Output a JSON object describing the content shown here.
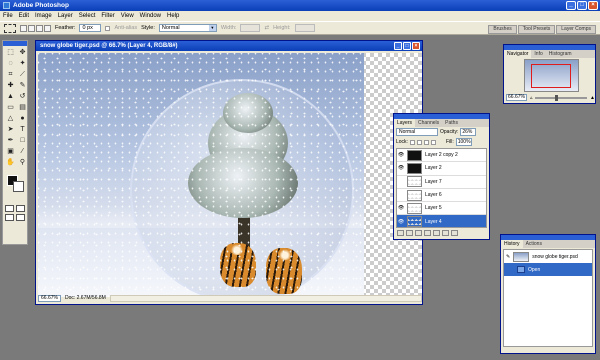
{
  "app": {
    "title": "Adobe Photoshop"
  },
  "menu": [
    "File",
    "Edit",
    "Image",
    "Layer",
    "Select",
    "Filter",
    "View",
    "Window",
    "Help"
  ],
  "options": {
    "feather_label": "Feather:",
    "feather_value": "0 px",
    "antialias_label": "Anti-alias",
    "style_label": "Style:",
    "style_value": "Normal",
    "width_label": "Width:",
    "height_label": "Height:"
  },
  "palette_well": [
    "Brushes",
    "Tool Presets",
    "Layer Comps"
  ],
  "document": {
    "title": "snow globe tiger.psd @ 66.7% (Layer 4, RGB/8#)",
    "zoom": "66.67%",
    "doc_size": "Doc: 2.67M/56.8M"
  },
  "navigator": {
    "tabs": [
      "Navigator",
      "Info",
      "Histogram"
    ],
    "zoom": "66.67%"
  },
  "layers": {
    "tabs": [
      "Layers",
      "Channels",
      "Paths"
    ],
    "blend_mode": "Normal",
    "opacity_label": "Opacity:",
    "opacity_value": "26%",
    "lock_label": "Lock:",
    "fill_label": "Fill:",
    "fill_value": "100%",
    "items": [
      {
        "name": "Layer 2 copy 2",
        "visible": true,
        "thumb": "dark"
      },
      {
        "name": "Layer 2",
        "visible": true,
        "thumb": "dark"
      },
      {
        "name": "Layer 7",
        "visible": false,
        "thumb": "checker"
      },
      {
        "name": "Layer 6",
        "visible": false,
        "thumb": "checker"
      },
      {
        "name": "Layer 5",
        "visible": true,
        "thumb": "checker"
      },
      {
        "name": "Layer 4",
        "visible": true,
        "thumb": "checker",
        "selected": true
      }
    ]
  },
  "history": {
    "tabs": [
      "History",
      "Actions"
    ],
    "snapshot": "snow globe tiger.psd",
    "state": "Open"
  },
  "colors": {
    "titlebar": "#0a3fb8",
    "selection": "#3169c6",
    "chrome": "#ece9d8"
  },
  "icons": {
    "eye": "eye-icon",
    "lasso": "lasso-icon",
    "move": "move-icon"
  }
}
